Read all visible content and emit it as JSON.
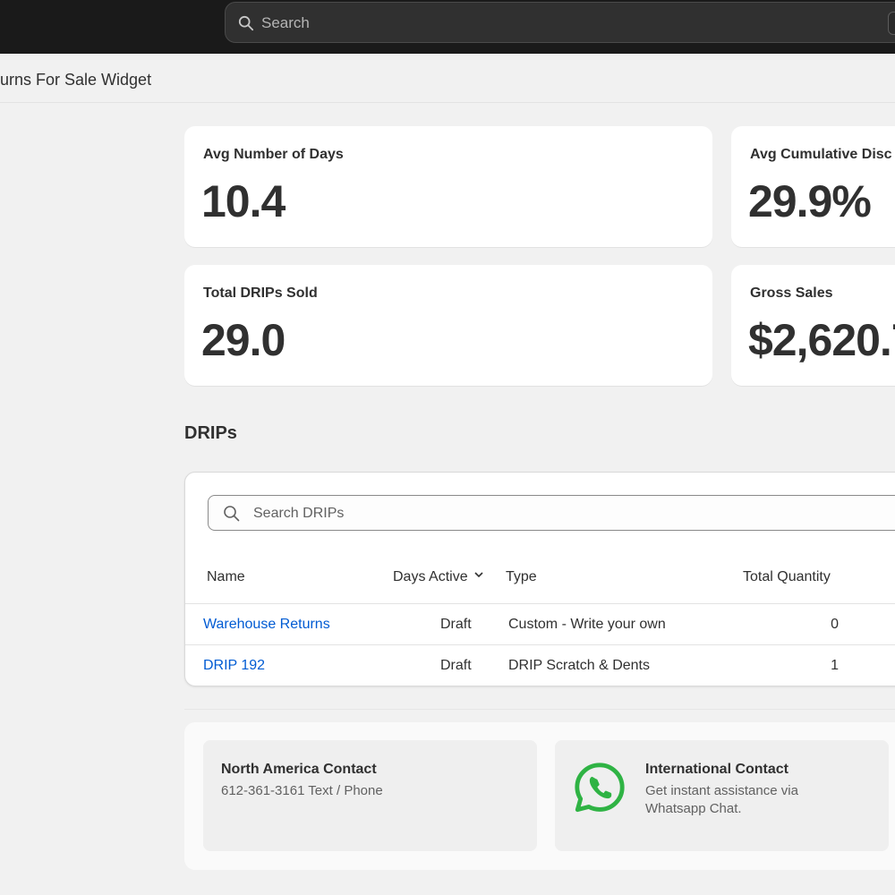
{
  "topbar": {
    "search_placeholder": "Search",
    "search_icon": "search-icon",
    "colors": {
      "background": "#1a1a1a",
      "search_bg": "#303030"
    }
  },
  "page": {
    "title": "urns For Sale Widget"
  },
  "metrics": [
    {
      "label": "Avg Number of Days",
      "value": "10.4"
    },
    {
      "label": "Avg Cumulative Disc",
      "value": "29.9%"
    },
    {
      "label": "Total DRIPs Sold",
      "value": "29.0"
    },
    {
      "label": "Gross Sales",
      "value": "$2,620.7"
    }
  ],
  "drips": {
    "section_title": "DRIPs",
    "search_placeholder": "Search DRIPs",
    "columns": {
      "name": "Name",
      "days_active": "Days Active",
      "type": "Type",
      "total_quantity": "Total Quantity"
    },
    "sort_indicator": "chevron-down-icon",
    "rows": [
      {
        "name": "Warehouse Returns",
        "days_active": "Draft",
        "type": "Custom - Write your own",
        "total_quantity": "0"
      },
      {
        "name": "DRIP 192",
        "days_active": "Draft",
        "type": "DRIP Scratch & Dents",
        "total_quantity": "1"
      }
    ],
    "link_color": "#005bd3"
  },
  "contacts": {
    "north_america": {
      "title": "North America Contact",
      "text": "612-361-3161 Text / Phone"
    },
    "international": {
      "title": "International Contact",
      "text": "Get instant assistance via Whatsapp Chat.",
      "icon": "whatsapp-icon",
      "icon_color": "#2fb344"
    }
  }
}
